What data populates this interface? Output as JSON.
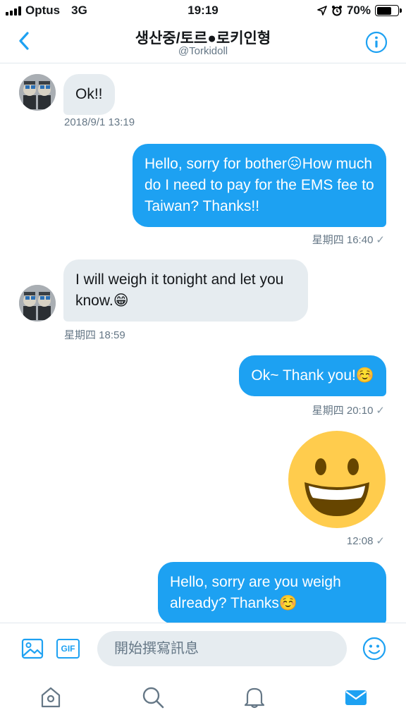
{
  "status_bar": {
    "carrier": "Optus",
    "network": "3G",
    "time": "19:19",
    "battery": "70%",
    "battery_level": 0.7
  },
  "header": {
    "title": "생산중/토르●로키인형",
    "handle": "@Torkidoll",
    "back_icon": "chevron-left-icon",
    "info_icon": "info-circle-icon"
  },
  "messages": [
    {
      "side": "in",
      "text": "Ok!!",
      "time": "2018/9/1 13:19"
    },
    {
      "side": "out",
      "text": "Hello, sorry for bother😖How much do I need to pay for the EMS fee to Taiwan? Thanks!!",
      "time": "星期四 16:40"
    },
    {
      "side": "in",
      "text": "I will weigh it tonight and let you know.😁",
      "time": "星期四 18:59"
    },
    {
      "side": "out",
      "text": "Ok~ Thank you!☺️",
      "time": "星期四 20:10"
    },
    {
      "side": "out",
      "kind": "emoji",
      "emoji_name": "grinning-face",
      "time": "12:08"
    },
    {
      "side": "out",
      "text": "Hello, sorry are you weigh already? Thanks☺️"
    }
  ],
  "composer": {
    "placeholder": "開始撰寫訊息",
    "image_icon": "image-icon",
    "gif_label": "GIF",
    "emoji_icon": "smiley-icon"
  },
  "tabs": [
    {
      "name": "home",
      "icon": "home-icon",
      "active": false
    },
    {
      "name": "search",
      "icon": "search-icon",
      "active": false
    },
    {
      "name": "notifications",
      "icon": "bell-icon",
      "active": false
    },
    {
      "name": "messages",
      "icon": "mail-icon",
      "active": true
    }
  ],
  "colors": {
    "accent": "#1da1f2",
    "incoming_bubble": "#e6ecf0",
    "muted_text": "#657786"
  }
}
